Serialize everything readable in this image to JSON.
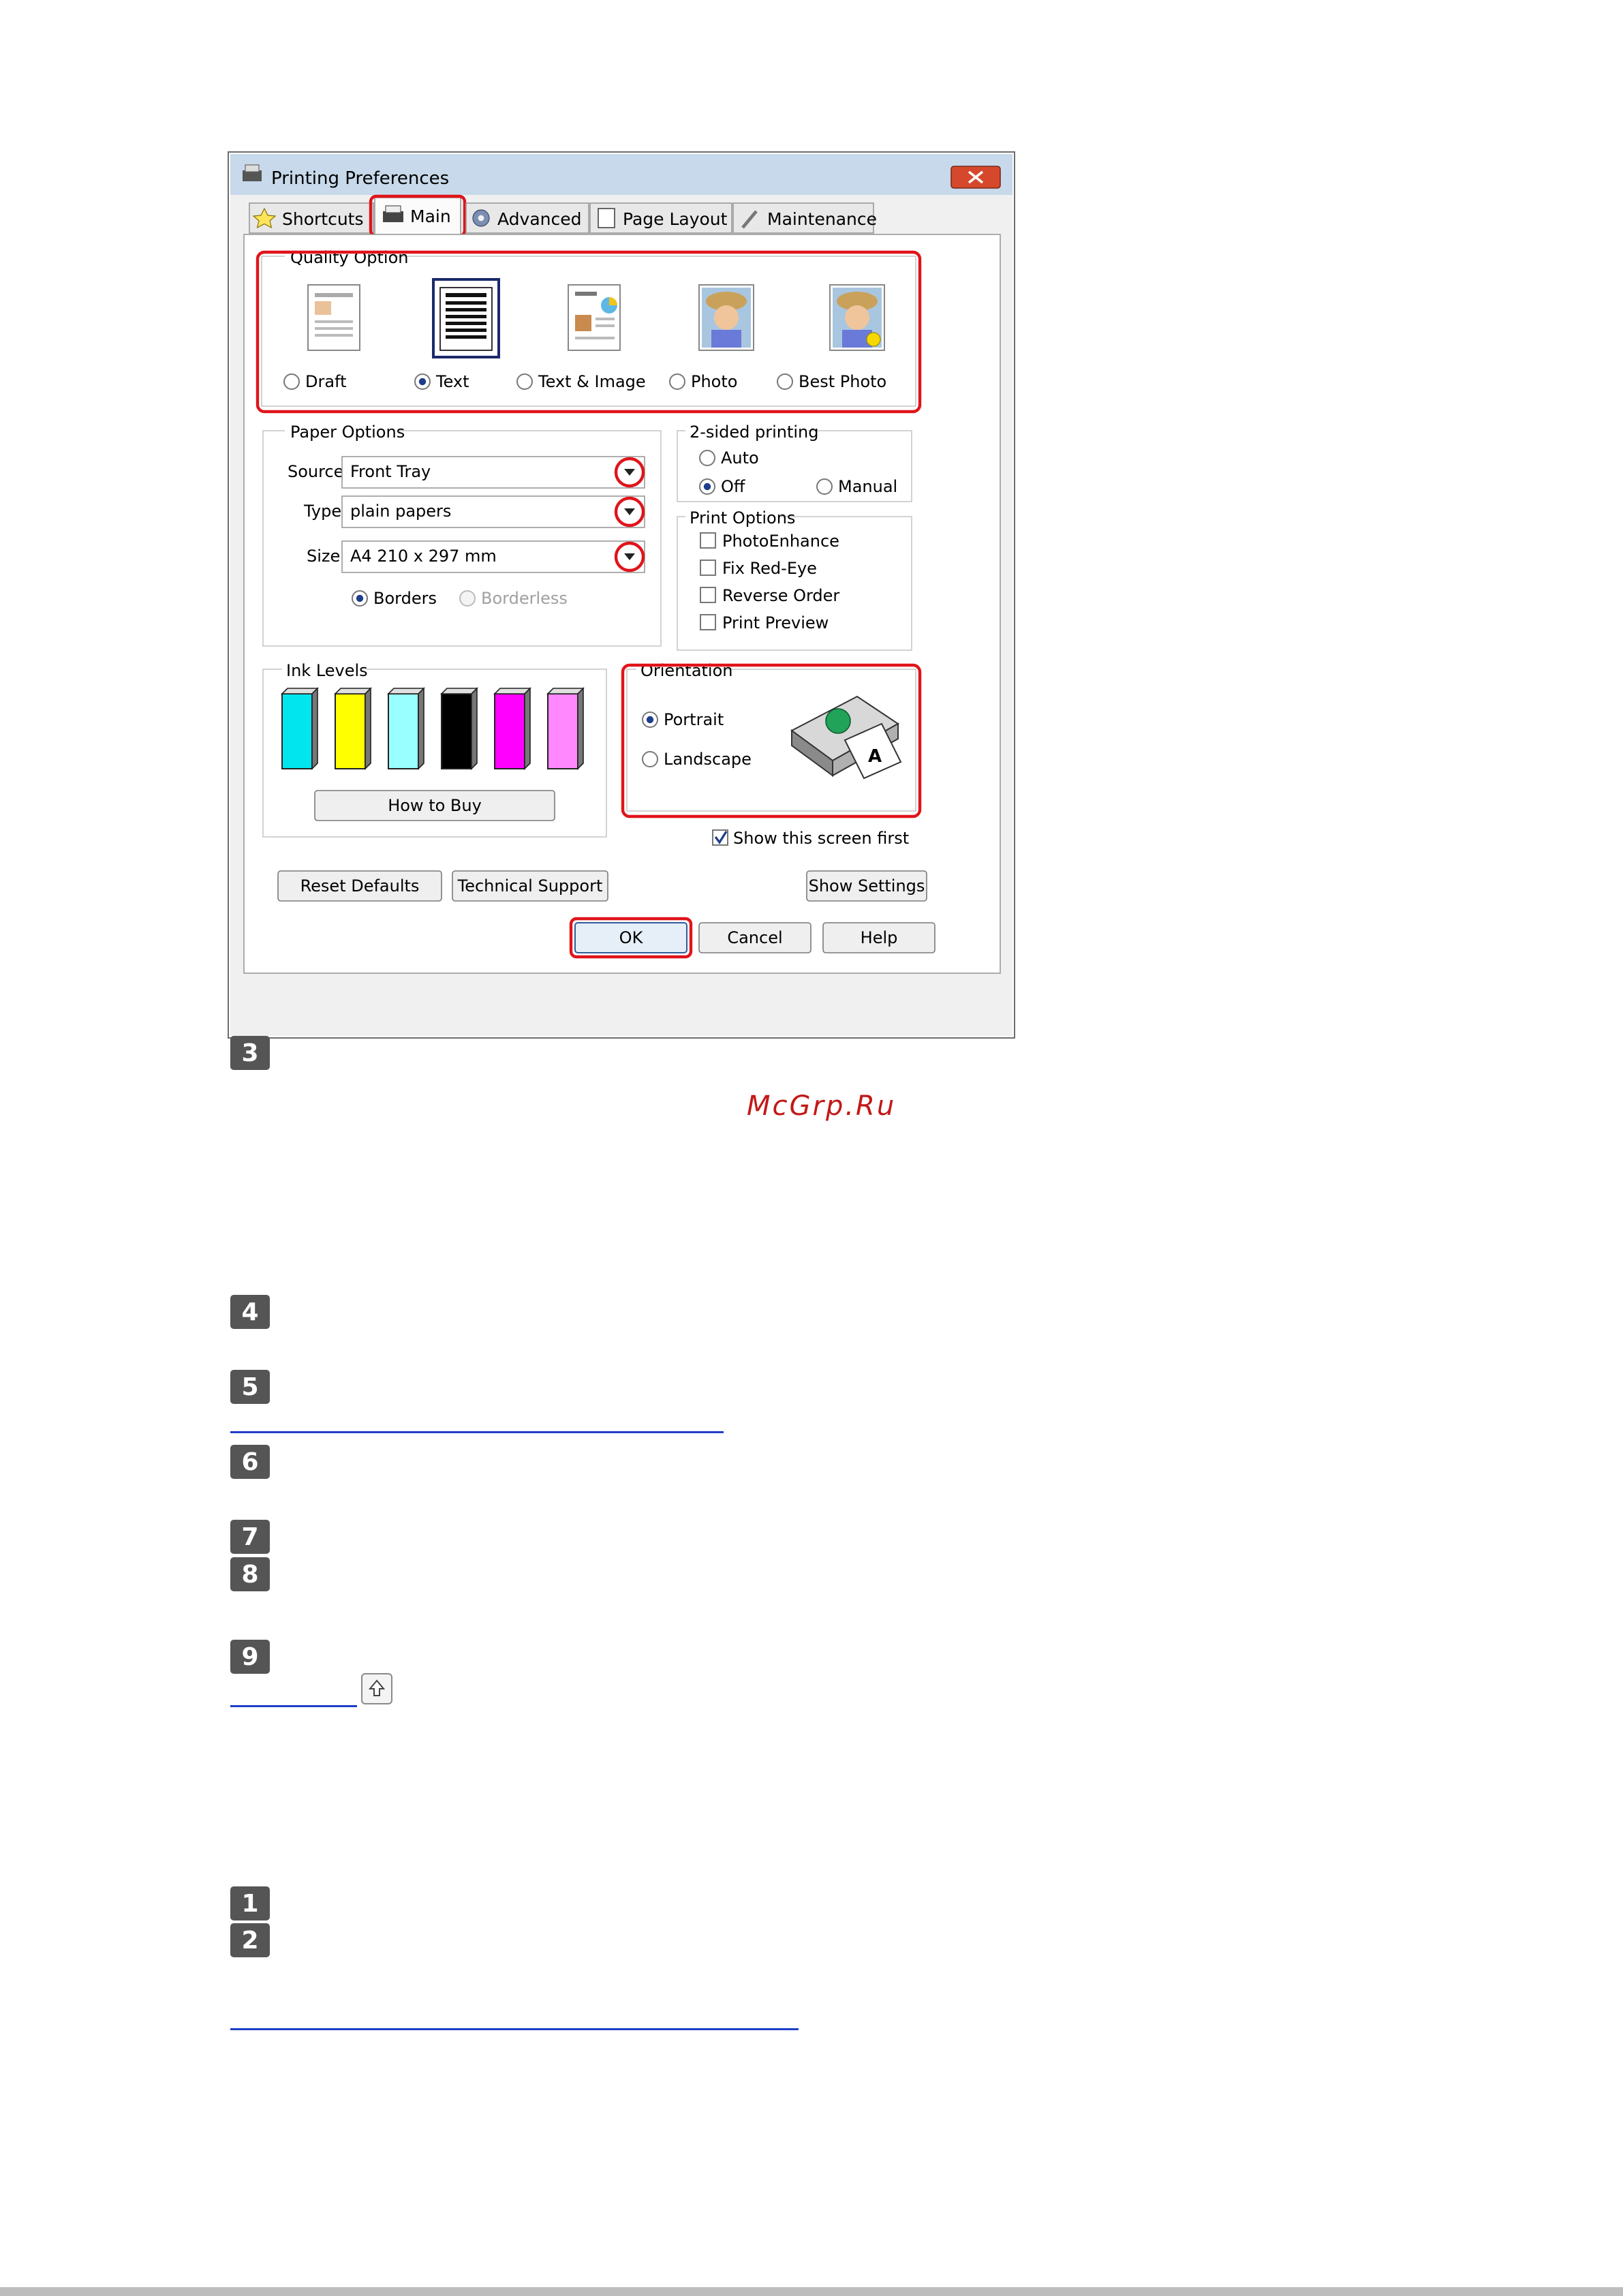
{
  "dialog": {
    "title": "Printing Preferences",
    "tabs": [
      "Shortcuts",
      "Main",
      "Advanced",
      "Page Layout",
      "Maintenance"
    ],
    "active_tab": "Main",
    "quality_option": {
      "label": "Quality Option",
      "options": [
        "Draft",
        "Text",
        "Text & Image",
        "Photo",
        "Best Photo"
      ],
      "selected": "Text"
    },
    "paper_options": {
      "label": "Paper Options",
      "source_label": "Source",
      "source_value": "Front Tray",
      "type_label": "Type",
      "type_value": "plain papers",
      "size_label": "Size",
      "size_value": "A4 210 x 297 mm",
      "borders_label": "Borders",
      "borderless_label": "Borderless",
      "selected_border": "Borders"
    },
    "two_sided": {
      "label": "2-sided printing",
      "auto": "Auto",
      "off": "Off",
      "manual": "Manual",
      "selected": "Off"
    },
    "print_options": {
      "label": "Print Options",
      "items": [
        "PhotoEnhance",
        "Fix Red-Eye",
        "Reverse Order",
        "Print Preview"
      ]
    },
    "ink_levels": {
      "label": "Ink Levels",
      "colors": [
        "#00e5ee",
        "#ffff00",
        "#99ffff",
        "#000000",
        "#ff00ff",
        "#ff88ff"
      ],
      "how_to_buy": "How to Buy"
    },
    "orientation": {
      "label": "Orientation",
      "portrait": "Portrait",
      "landscape": "Landscape",
      "selected": "Portrait"
    },
    "show_screen_first": "Show this screen first",
    "buttons": {
      "reset_defaults": "Reset Defaults",
      "technical_support": "Technical Support",
      "show_settings": "Show Settings",
      "ok": "OK",
      "cancel": "Cancel",
      "help": "Help"
    },
    "highlight_color": "#e0141a"
  },
  "steps": [
    "3",
    "4",
    "5",
    "6",
    "7",
    "8",
    "9",
    "1",
    "2"
  ],
  "watermark": "McGrp.Ru"
}
